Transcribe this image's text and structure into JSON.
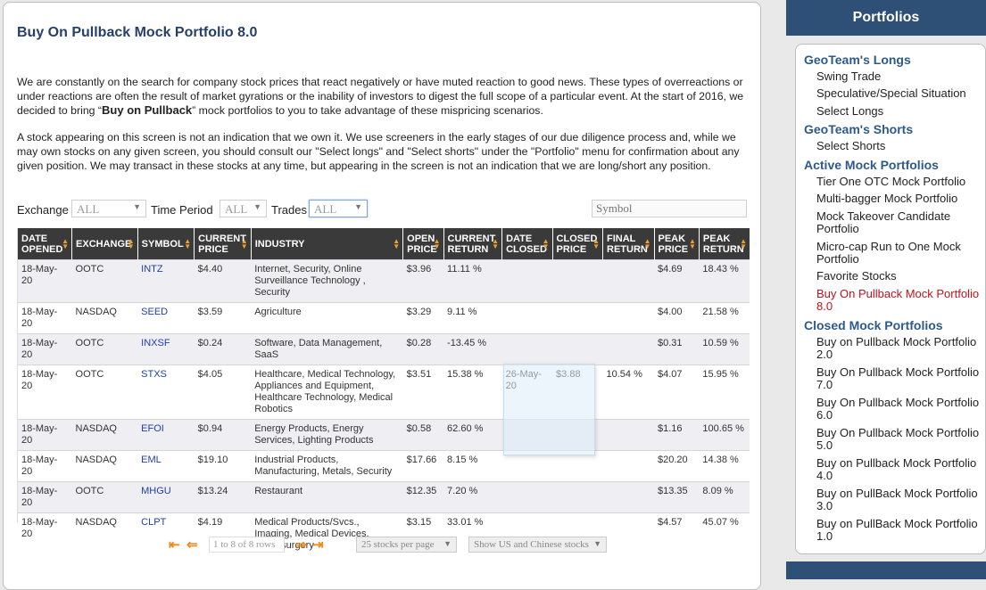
{
  "page": {
    "title": "Buy On Pullback Mock Portfolio 8.0",
    "intro": {
      "before": "We are constantly on the search for company stock prices that react negatively or have muted reaction to good news.  These types of overreactions or under reactions are often the result of market gyrations or the inability of investors to digest the full scope of a particular event.  At the start of 2016, we decided to bring “",
      "bold": "Buy on Pullback",
      "after": "” mock portfolios to you to take advantage of these mispricing scenarios."
    },
    "disclaimer": "A stock appearing on this screen is not an indication that we own it. We use screeners in the early stages of our due diligence process and, while we may own stocks on any given screen, you should consult our \"Select longs\" and \"Select shorts\" under the \"Portfolio\" menu for confirmation about any given position. We may transact in these stocks at any time, but appearing in the screen is not an indication that we are long/short any position."
  },
  "filters": {
    "exchange_label": "Exchange",
    "exchange_value": "ALL",
    "period_label": "Time Period",
    "period_value": "ALL",
    "trades_label": "Trades",
    "trades_value": "ALL",
    "symbol_placeholder": "Symbol"
  },
  "table": {
    "columns": [
      "DATE OPENED",
      "EXCHANGE",
      "SYMBOL",
      "CURRENT PRICE",
      "INDUSTRY",
      "OPEN PRICE",
      "CURRENT RETURN",
      "DATE CLOSED",
      "CLOSED PRICE",
      "FINAL RETURN",
      "PEAK PRICE",
      "PEAK RETURN"
    ],
    "rows": [
      [
        "18-May-20",
        "OOTC",
        "INTZ",
        "$4.40",
        "Internet, Security, Online Surveillance Technology , Security",
        "$3.96",
        "11.11 %",
        "",
        "",
        "",
        "$4.69",
        "18.43 %"
      ],
      [
        "18-May-20",
        "NASDAQ",
        "SEED",
        "$3.59",
        "Agriculture",
        "$3.29",
        "9.11 %",
        "",
        "",
        "",
        "$4.00",
        "21.58 %"
      ],
      [
        "18-May-20",
        "OOTC",
        "INXSF",
        "$0.24",
        "Software, Data Management, SaaS",
        "$0.28",
        "-13.45 %",
        "",
        "",
        "",
        "$0.31",
        "10.59 %"
      ],
      [
        "18-May-20",
        "OOTC",
        "STXS",
        "$4.05",
        "Healthcare, Medical Technology, Appliances and Equipment, Healthcare Technology, Medical Robotics",
        "$3.51",
        "15.38 %",
        "26-May-20",
        "$3.88",
        "10.54 %",
        "$4.07",
        "15.95 %"
      ],
      [
        "18-May-20",
        "NASDAQ",
        "EFOI",
        "$0.94",
        "Energy Products, Energy Services, Lighting Products",
        "$0.58",
        "62.60 %",
        "",
        "",
        "",
        "$1.16",
        "100.65 %"
      ],
      [
        "18-May-20",
        "NASDAQ",
        "EML",
        "$19.10",
        "Industrial Products, Manufacturing, Metals, Security",
        "$17.66",
        "8.15 %",
        "",
        "",
        "",
        "$20.20",
        "14.38 %"
      ],
      [
        "18-May-20",
        "OOTC",
        "MHGU",
        "$13.24",
        "Restaurant",
        "$12.35",
        "7.20 %",
        "",
        "",
        "",
        "$13.35",
        "8.09 %"
      ],
      [
        "18-May-20",
        "NASDAQ",
        "CLPT",
        "$4.19",
        "Medical Products/Svcs., Imaging, Medical Devices, Neurosurgery",
        "$3.15",
        "33.01 %",
        "",
        "",
        "",
        "$4.57",
        "45.07 %"
      ]
    ]
  },
  "pager": {
    "info": "1 to 8 of 8 rows",
    "per_page": "25 stocks per page",
    "market": "Show US and Chinese stocks"
  },
  "sidebar": {
    "title": "Portfolios",
    "groups": [
      {
        "label": "GeoTeam's Longs",
        "items": [
          "Swing Trade",
          "Speculative/Special Situation",
          "Select Longs"
        ]
      },
      {
        "label": "GeoTeam's Shorts",
        "items": [
          "Select Shorts"
        ]
      },
      {
        "label": "Active Mock Portfolios",
        "items": [
          "Tier One OTC Mock Portfolio",
          "Multi-bagger Mock Portfolio",
          "Mock Takeover Candidate Portfolio",
          "Micro-cap Run to One Mock Portfolio",
          "Favorite Stocks",
          "Buy On Pullback Mock Portfolio 8.0"
        ]
      },
      {
        "label": "Closed Mock Portfolios",
        "items": [
          "Buy on Pullback Mock Portfolio 2.0",
          "Buy On Pullback Mock Portfolio 7.0",
          "Buy On Pullback Mock Portfolio 6.0",
          "Buy On Pullback Mock Portfolio 5.0",
          "Buy on Pullback Mock Portfolio 4.0",
          "Buy on PullBack Mock Portfolio 3.0",
          "Buy on PullBack Mock Portfolio 1.0"
        ]
      }
    ]
  },
  "colors": {
    "accent": "#2e5077",
    "active_link": "#c0121b",
    "sort_arrow": "#f0a030"
  }
}
